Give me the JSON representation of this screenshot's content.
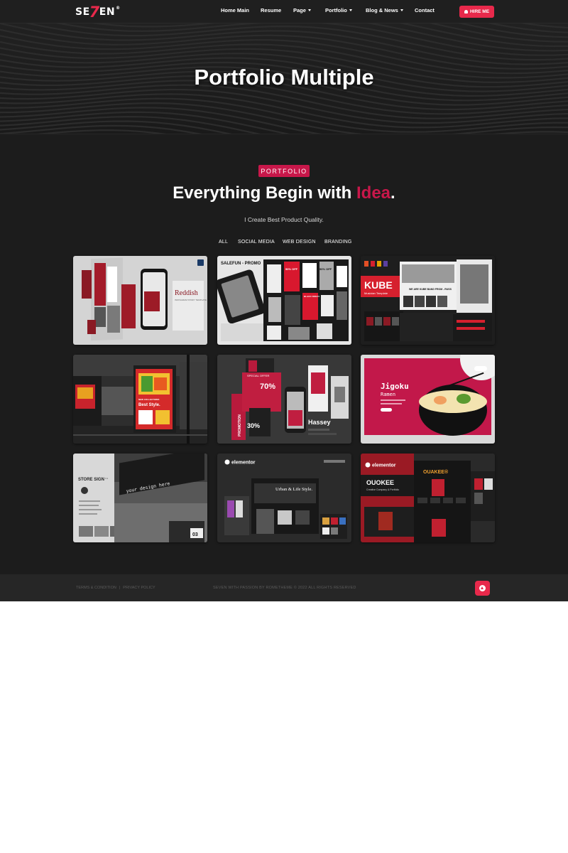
{
  "nav": {
    "logo": {
      "left": "SE",
      "seven": "7",
      "right": "EN",
      "mark": "®"
    },
    "menu": [
      {
        "label": "Home Main",
        "dropdown": false
      },
      {
        "label": "Resume",
        "dropdown": false
      },
      {
        "label": "Page",
        "dropdown": true
      },
      {
        "label": "Portfolio",
        "dropdown": true
      },
      {
        "label": "Blog & News",
        "dropdown": true
      },
      {
        "label": "Contact",
        "dropdown": false
      }
    ],
    "hire_label": "HIRE ME",
    "hire_icon": "bell-icon"
  },
  "hero": {
    "title": "Portfolio Multiple"
  },
  "section": {
    "badge": "PORTFOLIO",
    "heading_pre": "Everything Begin with",
    "heading_accent": "Idea",
    "heading_post": ".",
    "subtext": "I Create Best Product Quality.",
    "filters": [
      "ALL",
      "SOCIAL MEDIA",
      "WEB DESIGN",
      "BRANDING"
    ]
  },
  "portfolio": {
    "items": [
      {
        "title": "Reddish",
        "subtitle": "INSTAGRAM STORY TEMPLATE"
      },
      {
        "title": "SALEFUN - PROMO",
        "tags": [
          "50% OFF",
          "BLACK FRIDAY",
          "50% OFF"
        ]
      },
      {
        "title": "KUBE",
        "subtitle": "Musician Template",
        "caption": "WE ARE KUBE BAND FROM - RUSS"
      },
      {
        "title": "Best Style.",
        "caption": "NEW COLLECTIONS"
      },
      {
        "title": "Hassey",
        "tags": [
          "SPECIAL OFFER",
          "70%",
          "30%",
          "PROMOTION"
        ]
      },
      {
        "title": "Jigoku",
        "subtitle": "Ramen"
      },
      {
        "title": "STORE SIGN",
        "version": "V.1",
        "sign_text": "your design here",
        "number": "03"
      },
      {
        "brand": "elementor",
        "title": "Urban & Life Style."
      },
      {
        "brand": "elementor",
        "title": "OUOKEE",
        "badge": "OUAKEE®",
        "subtitle": "Creative Company & Portfolio"
      }
    ]
  },
  "footer": {
    "links": [
      "TERMS & CONDITION",
      "|",
      "PRIVACY POLICY"
    ],
    "copyright": "SEVEN WITH PASSION BY ROMETHEME © 2022 ALL RIGHTS RESERVED",
    "to_top_icon": "arrow-up-icon"
  },
  "colors": {
    "accent": "#e8294b",
    "crimson": "#c8174a",
    "background": "#1c1c1c"
  }
}
